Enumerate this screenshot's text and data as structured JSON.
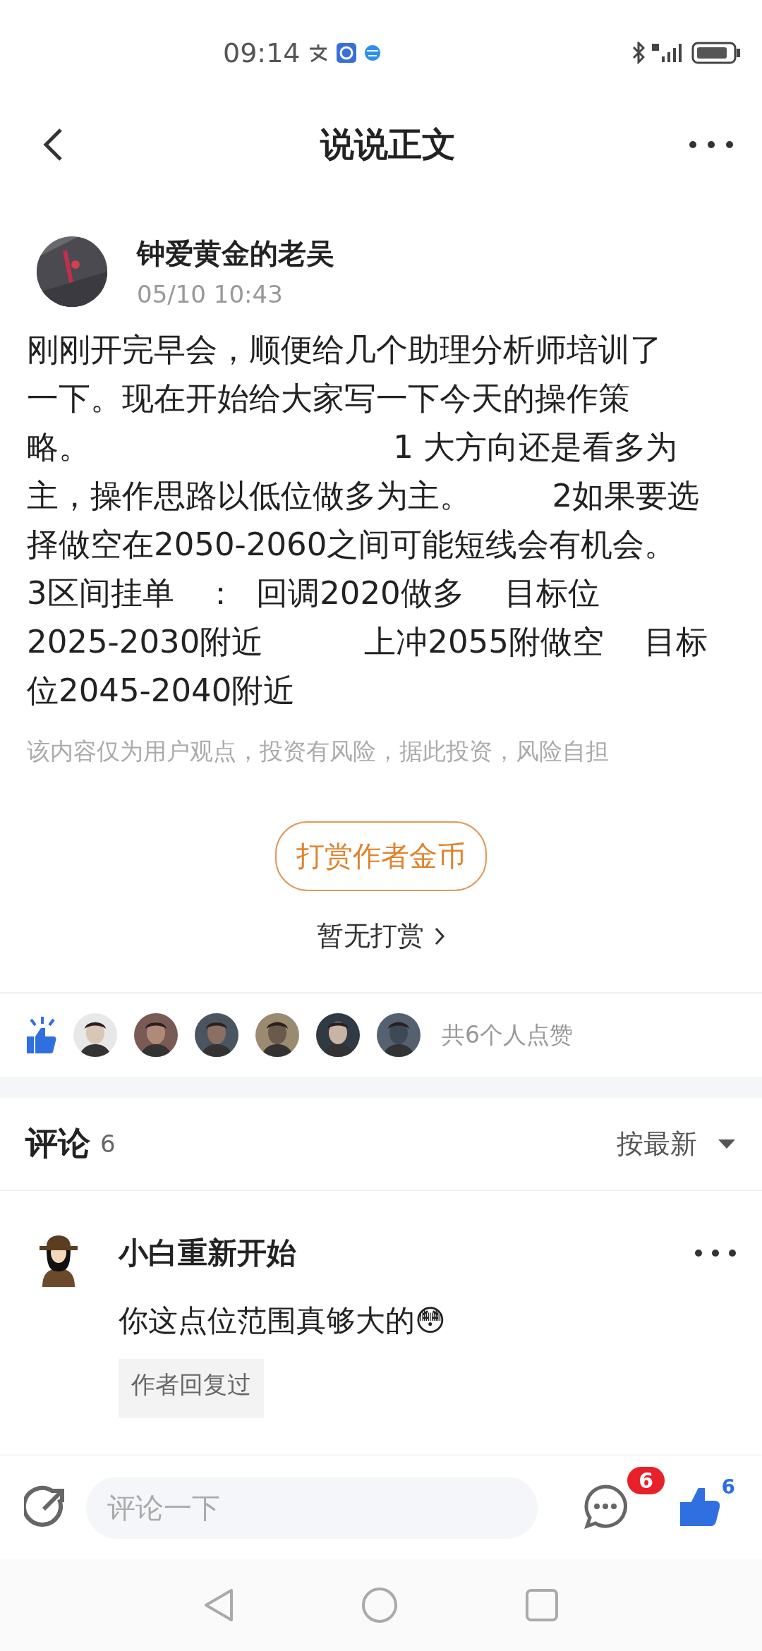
{
  "status_bar": {
    "time": "09:14"
  },
  "header": {
    "title": "说说正文"
  },
  "post": {
    "author": "钟爱黄金的老吴",
    "time": "05/10 10:43",
    "body_lines": [
      "刚刚开完早会，顺便给几个助理分析师培训了",
      "一下。现在开始给大家写一下今天的操作策",
      "略。                              1 大方向还是看多为",
      "主，操作思路以低位做多为主。        2如果要选",
      "择做空在2050-2060之间可能短线会有机会。",
      "3区间挂单   ：  回调2020做多    目标位",
      "2025-2030附近          上冲2055附做空    目标",
      "位2045-2040附近"
    ],
    "disclaimer": "该内容仅为用户观点，投资有风险，据此投资，风险自担"
  },
  "reward": {
    "button": "打赏作者金币",
    "status": "暂无打赏"
  },
  "likes": {
    "summary": "共6个人点赞"
  },
  "comments": {
    "title": "评论",
    "count": "6",
    "sort": "按最新",
    "items": [
      {
        "name": "小白重新开始",
        "text": "你这点位范围真够大的😳",
        "tag": "作者回复过"
      }
    ]
  },
  "bottom_bar": {
    "placeholder": "评论一下",
    "comment_badge": "6",
    "like_count": "6",
    "liked": true
  }
}
